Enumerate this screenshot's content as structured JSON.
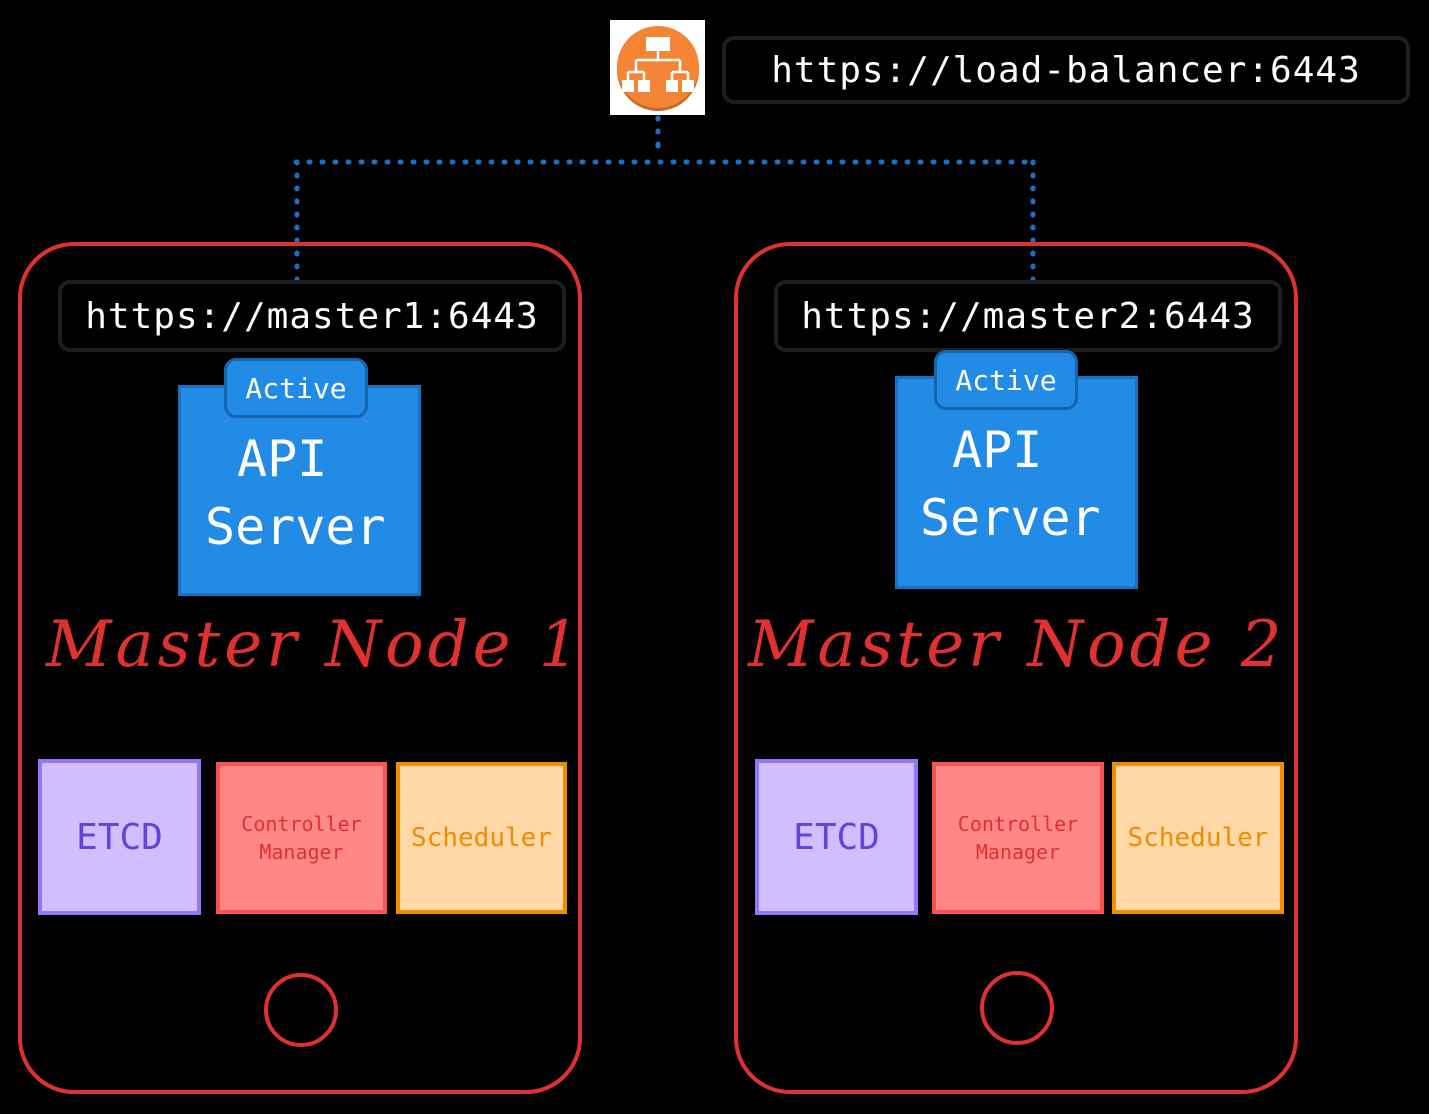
{
  "load_balancer": {
    "icon": "load-balancer-icon",
    "icon_color": "#f58536",
    "url": "https://load-balancer:6443"
  },
  "connector_color": "#1971c2",
  "nodes": [
    {
      "label": "Master Node 1",
      "url": "https://master1:6443",
      "api_server": {
        "status": "Active",
        "line1": "API",
        "line2": "Server"
      },
      "components": {
        "etcd": "ETCD",
        "controller_line1": "Controller",
        "controller_line2": "Manager",
        "scheduler": "Scheduler"
      }
    },
    {
      "label": "Master Node 2",
      "url": "https://master2:6443",
      "api_server": {
        "status": "Active",
        "line1": "API",
        "line2": "Server"
      },
      "components": {
        "etcd": "ETCD",
        "controller_line1": "Controller",
        "controller_line2": "Manager",
        "scheduler": "Scheduler"
      }
    }
  ],
  "colors": {
    "node_border": "#e03131",
    "api_fill": "#228be6",
    "etcd_fill": "#d0bfff",
    "controller_fill": "#ff8787",
    "scheduler_fill": "#ffd8a8"
  }
}
